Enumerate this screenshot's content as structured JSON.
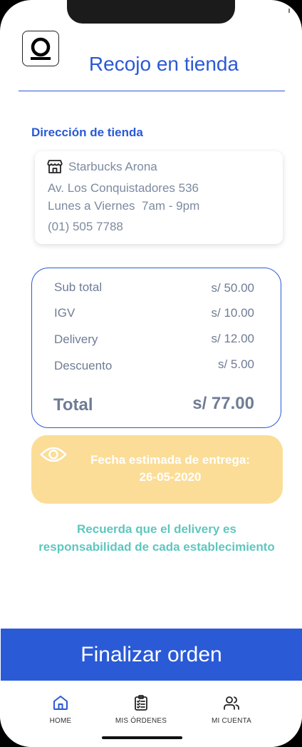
{
  "header": {
    "title": "Recojo en tienda"
  },
  "store": {
    "section_label": "Dirección de tienda",
    "name": "Starbucks Arona",
    "address": "Av. Los Conquistadores 536",
    "hours": "Lunes a Viernes  7am - 9pm",
    "phone": "(01) 505 7788"
  },
  "summary": {
    "rows": [
      {
        "label": "Sub total",
        "value": "s/ 50.00"
      },
      {
        "label": "IGV",
        "value": "s/ 10.00"
      },
      {
        "label": "Delivery",
        "value": "s/ 12.00"
      },
      {
        "label": "Descuento",
        "value": "s/ 5.00"
      }
    ],
    "total_label": "Total",
    "total_value": "s/ 77.00"
  },
  "eta": {
    "title": "Fecha estimada de entrega:",
    "date": "26-05-2020"
  },
  "note": {
    "line1": "Recuerda que el delivery es",
    "line2": "responsabilidad de cada establecimiento"
  },
  "actions": {
    "finish_label": "Finalizar orden"
  },
  "tabbar": {
    "home": "HOME",
    "orders": "MIS ÓRDENES",
    "account": "MI CUENTA"
  },
  "icons": {
    "logo": "app-logo-icon",
    "store": "store-icon",
    "eye": "eye-icon",
    "home": "home-icon",
    "orders": "clipboard-list-icon",
    "account": "users-icon"
  },
  "colors": {
    "primary": "#2a59d4",
    "eta_background": "#fbdd97",
    "note_text": "#5ec7bd",
    "muted_text": "#6f7c95"
  }
}
